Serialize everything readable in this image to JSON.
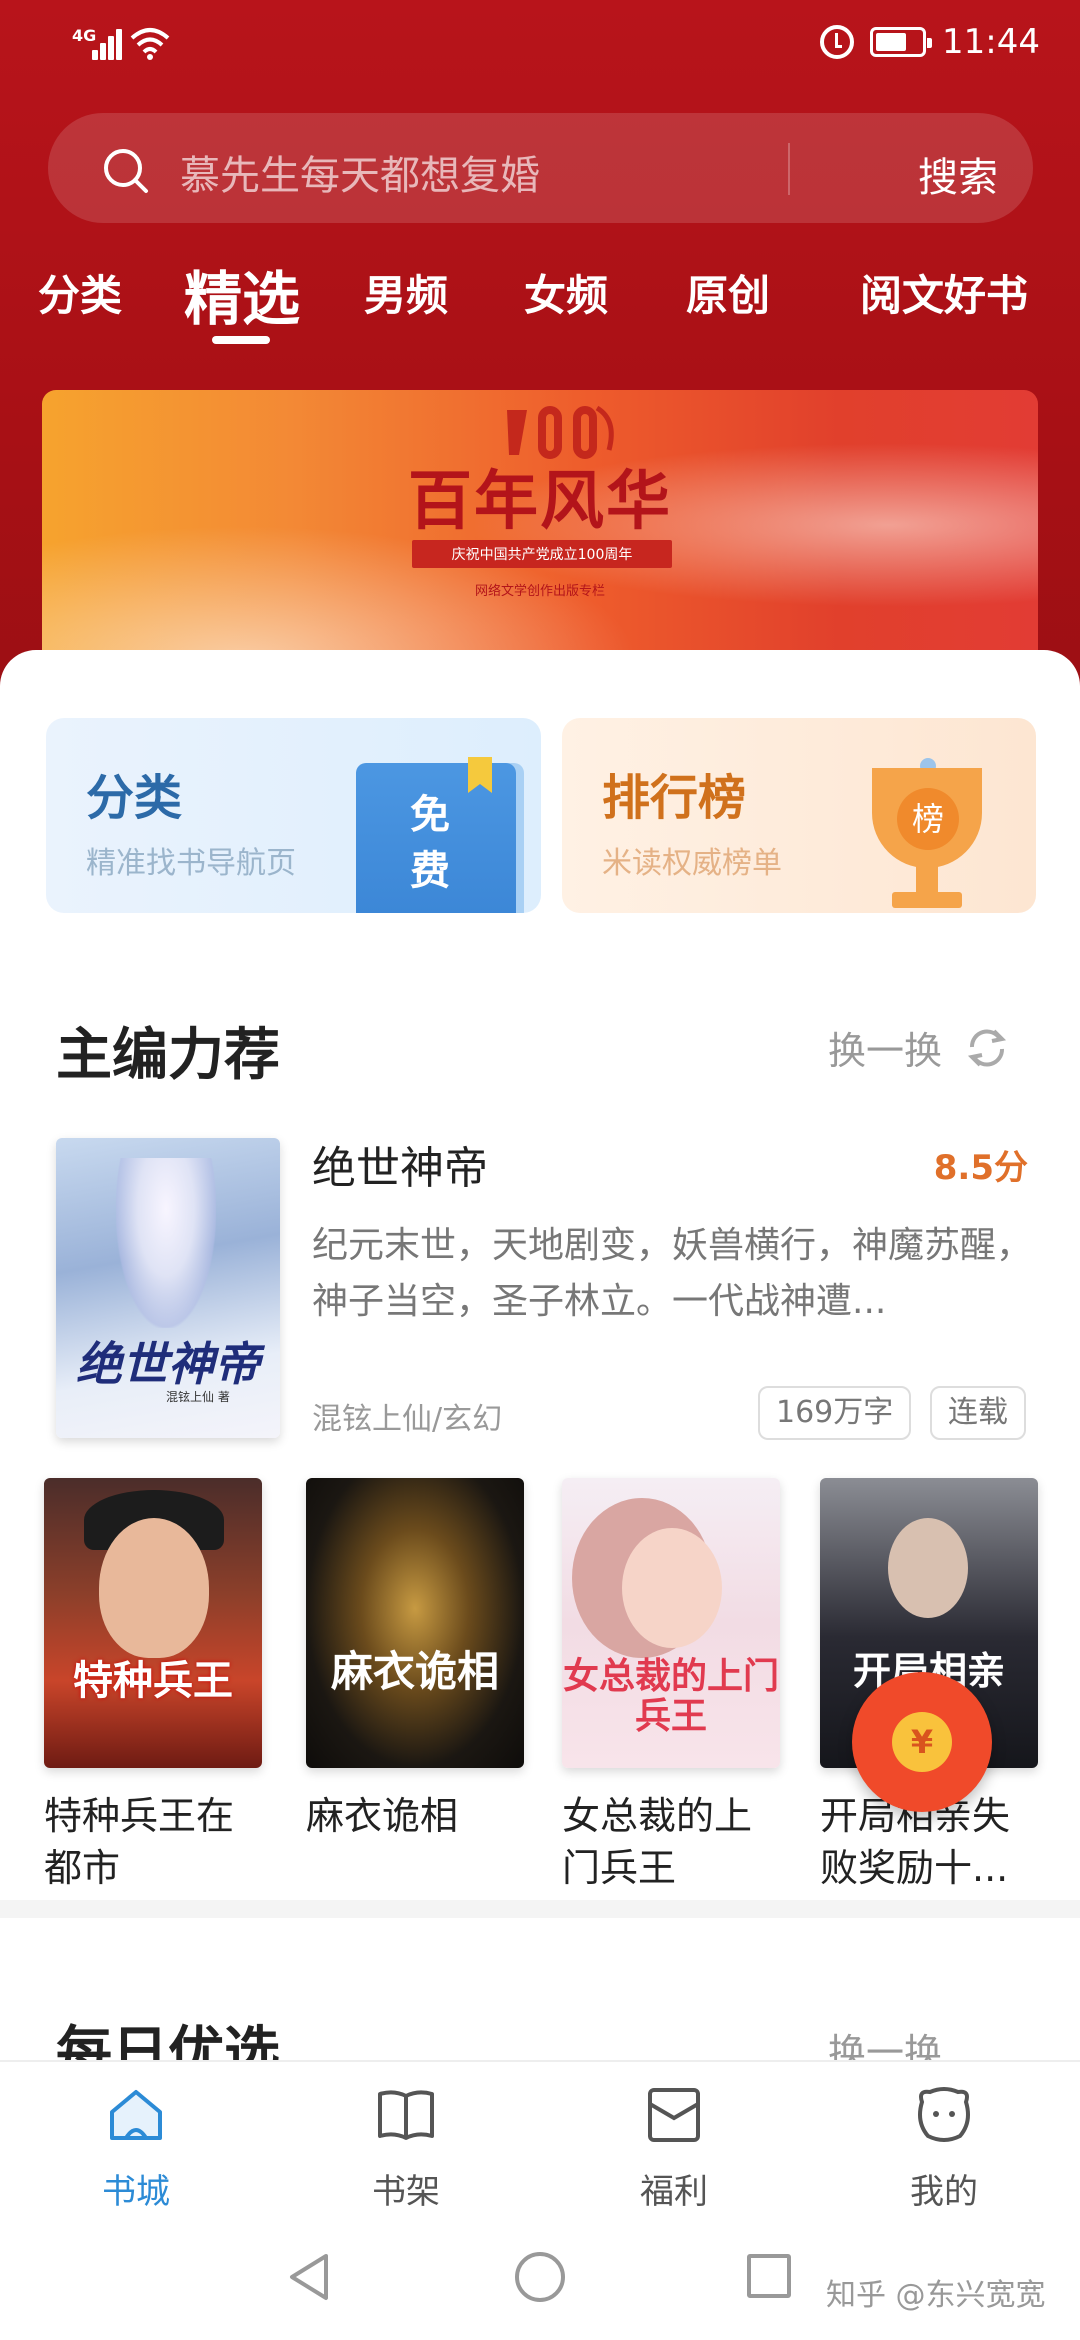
{
  "status_bar": {
    "network": "4G",
    "time": "11:44",
    "icons": [
      "signal-icon",
      "wifi-icon",
      "alarm-icon",
      "battery-icon"
    ]
  },
  "search": {
    "placeholder": "慕先生每天都想复婚",
    "button": "搜索"
  },
  "tabs": [
    {
      "label": "分类",
      "active": false
    },
    {
      "label": "精选",
      "active": true
    },
    {
      "label": "男频",
      "active": false
    },
    {
      "label": "女频",
      "active": false
    },
    {
      "label": "原创",
      "active": false
    },
    {
      "label": "阅文好书",
      "active": false
    }
  ],
  "banner": {
    "title": "百年风华",
    "subtitle": "庆祝中国共产党成立100周年",
    "caption": "网络文学创作出版专栏"
  },
  "quick_cards": [
    {
      "title": "分类",
      "subtitle": "精准找书导航页",
      "badge": "免费"
    },
    {
      "title": "排行榜",
      "subtitle": "米读权威榜单",
      "badge": "榜"
    }
  ],
  "recommend": {
    "section_title": "主编力荐",
    "refresh_label": "换一换",
    "featured": {
      "title": "绝世神帝",
      "score": "8.5分",
      "description": "纪元末世，天地剧变，妖兽横行，神魔苏醒，神子当空，圣子林立。一代战神遭...",
      "meta": "混铉上仙/玄幻",
      "words": "169万字",
      "status": "连载",
      "cover_title": "绝世神帝",
      "cover_author": "混铉上仙 著"
    },
    "books": [
      {
        "title": "特种兵王在都市",
        "cover_text": "特种兵王"
      },
      {
        "title": "麻衣诡相",
        "cover_text": "麻衣诡相"
      },
      {
        "title": "女总裁的上门兵王",
        "cover_text": "女总裁的上门兵王"
      },
      {
        "title": "开局相亲失败奖励十...",
        "cover_text": "开局相亲"
      }
    ]
  },
  "daily": {
    "section_title": "每日优选",
    "refresh_label": "换一换"
  },
  "redpacket": {
    "symbol": "¥"
  },
  "bottom_nav": [
    {
      "label": "书城",
      "icon": "home-icon",
      "active": true
    },
    {
      "label": "书架",
      "icon": "bookshelf-icon",
      "active": false
    },
    {
      "label": "福利",
      "icon": "gift-icon",
      "active": false
    },
    {
      "label": "我的",
      "icon": "profile-icon",
      "active": false
    }
  ],
  "watermark": "知乎 @东兴宽宽",
  "colors": {
    "header_red": "#b8141b",
    "accent_blue": "#2c8bd6",
    "score_orange": "#e0702a",
    "redpacket": "#f04a2a"
  }
}
